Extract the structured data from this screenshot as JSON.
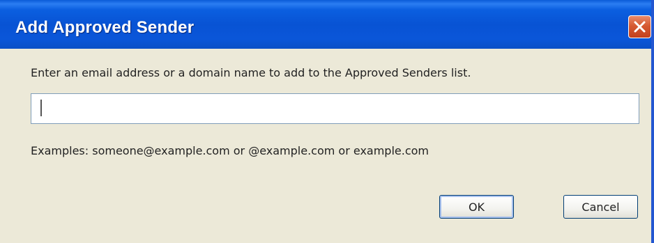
{
  "dialog": {
    "title": "Add Approved Sender",
    "instruction": "Enter an email address or a domain name to add to the Approved Senders list.",
    "input": {
      "value": "",
      "placeholder": ""
    },
    "examples": "Examples:  someone@example.com or  @example.com or example.com",
    "ok_label": "OK",
    "cancel_label": "Cancel"
  },
  "icons": {
    "close": "close-icon"
  },
  "colors": {
    "titlebar": "#0a56d9",
    "close_button": "#d65a32",
    "background": "#ECE9D8",
    "input_border": "#7f9db9"
  }
}
